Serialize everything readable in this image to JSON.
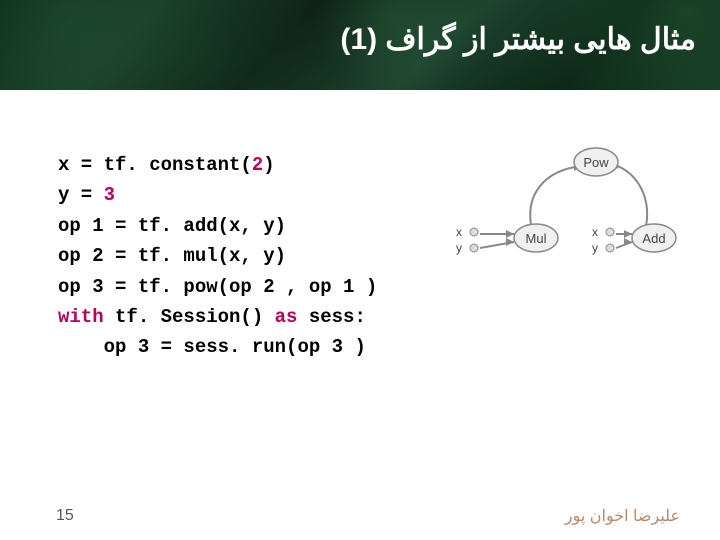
{
  "title": "مثال هایی بیشتر از گراف (1)",
  "code": {
    "lines": [
      {
        "pre": "x = tf. constant(",
        "num": "2",
        "post": ")"
      },
      {
        "pre": "y = ",
        "num": "3",
        "post": ""
      },
      {
        "pre": "op 1 = tf. add(x, y)",
        "num": "",
        "post": ""
      },
      {
        "pre": "op 2 = tf. mul(x, y)",
        "num": "",
        "post": ""
      },
      {
        "pre": "op 3 = tf. pow(op 2 , op 1 )",
        "num": "",
        "post": ""
      }
    ],
    "with_kw": "with",
    "with_rest": " tf. Session() ",
    "as_kw": "as",
    "as_rest": " sess:",
    "run_line": "    op 3 = sess. run(op 3 )"
  },
  "graph": {
    "nodes": {
      "pow": "Pow",
      "mul": "Mul",
      "add": "Add",
      "x": "x",
      "y": "y"
    }
  },
  "footer": {
    "page": "15",
    "author": "علیرضا اخوان پور"
  }
}
